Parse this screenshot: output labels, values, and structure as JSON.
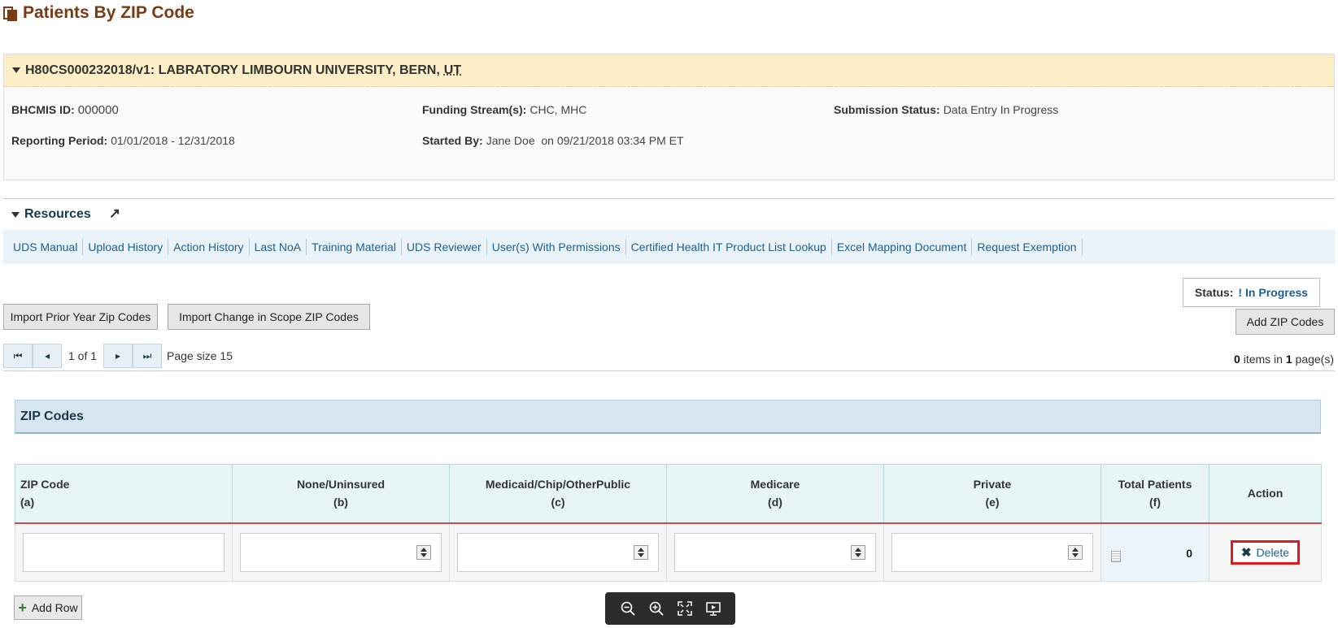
{
  "page": {
    "title": "Patients By ZIP Code"
  },
  "grant": {
    "header": "H80CS000232018/v1: LABRATORY LIMBOURN UNIVERSITY, BERN,",
    "state": "UT",
    "bhcmis_label": "BHCMIS ID:",
    "bhcmis_value": "000000",
    "funding_label": "Funding Stream(s):",
    "funding_value": "CHC, MHC",
    "submission_label": "Submission Status:",
    "submission_value": "Data Entry In Progress",
    "period_label": "Reporting Period:",
    "period_value": "01/01/2018 - 12/31/2018",
    "started_label": "Started By:",
    "started_value": "Jane Doe  on 09/21/2018 03:34 PM ET"
  },
  "resources": {
    "title": "Resources",
    "links": [
      "UDS Manual",
      "Upload History",
      "Action History",
      "Last NoA",
      "Training Material",
      "UDS Reviewer",
      "User(s) With Permissions",
      "Certified Health IT Product List Lookup",
      "Excel Mapping Document",
      "Request Exemption"
    ]
  },
  "status": {
    "label": "Status:",
    "icon": "!",
    "value": "In Progress"
  },
  "toolbar": {
    "import_prior": "Import Prior Year Zip Codes",
    "import_scope": "Import Change in Scope ZIP Codes",
    "add_zip": "Add ZIP Codes"
  },
  "pager": {
    "info": "1 of 1",
    "page_size": "Page size 15",
    "items_count": "0",
    "items_mid": " items in ",
    "pages_count": "1",
    "items_end": " page(s)"
  },
  "section": {
    "title": "ZIP Codes"
  },
  "table": {
    "columns": [
      {
        "name": "ZIP Code",
        "sub": "(a)"
      },
      {
        "name": "None/Uninsured",
        "sub": "(b)"
      },
      {
        "name": "Medicaid/Chip/OtherPublic",
        "sub": "(c)"
      },
      {
        "name": "Medicare",
        "sub": "(d)"
      },
      {
        "name": "Private",
        "sub": "(e)"
      },
      {
        "name": "Total Patients",
        "sub": "(f)"
      },
      {
        "name": "Action",
        "sub": ""
      }
    ],
    "row": {
      "total": "0",
      "delete_label": "Delete"
    }
  },
  "add_row": {
    "label": "Add Row"
  },
  "colors": {
    "title": "#7a3a12",
    "link": "#1f5f8b",
    "highlight": "#e0191f",
    "header_bg": "#fcefc7"
  }
}
